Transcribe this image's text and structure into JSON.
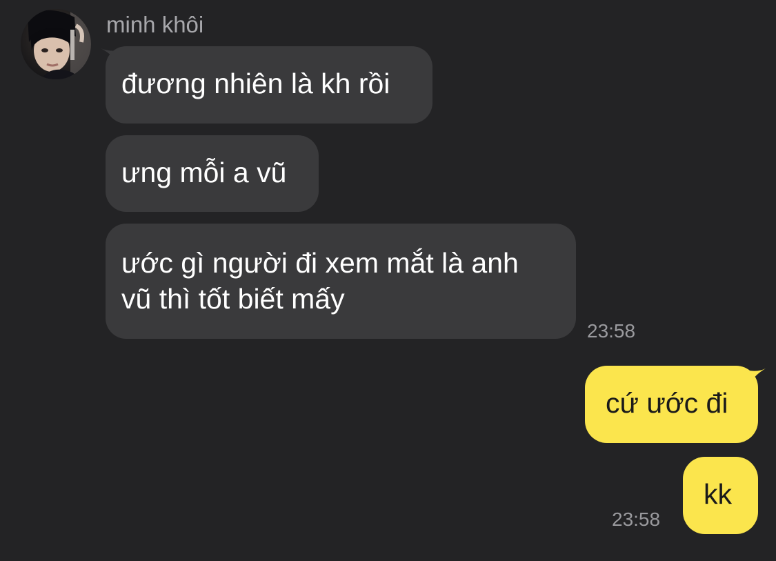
{
  "sender": {
    "name": "minh khôi"
  },
  "messages": {
    "incoming": [
      {
        "text": "đương nhiên là kh rồi"
      },
      {
        "text": "ưng mỗi a vũ"
      },
      {
        "line1": "ước gì người đi xem mắt là anh",
        "line2": "vũ thì tốt biết mấy"
      }
    ],
    "incoming_time": "23:58",
    "outgoing": [
      {
        "text": "cứ ước đi"
      },
      {
        "text": "kk"
      }
    ],
    "outgoing_time": "23:58"
  },
  "colors": {
    "background": "#232325",
    "incoming_bubble": "#3a3a3c",
    "outgoing_bubble": "#fbe54d",
    "timestamp": "#9a9a9e"
  },
  "icons": {
    "avatar": "profile-photo"
  }
}
